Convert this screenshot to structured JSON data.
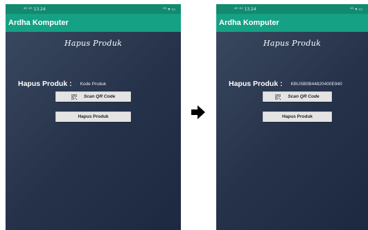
{
  "before": {
    "status_time": "13.24",
    "status_left": "⁴ᴳ ⁴ᴳ",
    "status_right": "⁴ᴳ ▾ ▭",
    "app_title": "Ardha Komputer",
    "page_title": "Hapus Produk",
    "field_label": "Hapus Produk :",
    "field_value": "Kode Produk",
    "scan_button": "Scan QR Code",
    "delete_button": "Hapus Produk"
  },
  "after": {
    "status_time": "13.24",
    "status_left": "⁴ᴳ ⁴ᴳ",
    "status_right": "⁴ᴳ ▾ ▭",
    "app_title": "Ardha Komputer",
    "page_title": "Hapus Produk",
    "field_label": "Hapus Produk :",
    "field_value": "KBUSB0B44820400E940",
    "scan_button": "Scan QR Code",
    "delete_button": "Hapus Produk"
  },
  "colors": {
    "status_bar": "#138a6f",
    "app_bar": "#15a184",
    "background_start": "#3c4a62",
    "background_end": "#1d2940"
  },
  "icons": [
    "qr-code-icon",
    "right-arrow-icon"
  ]
}
